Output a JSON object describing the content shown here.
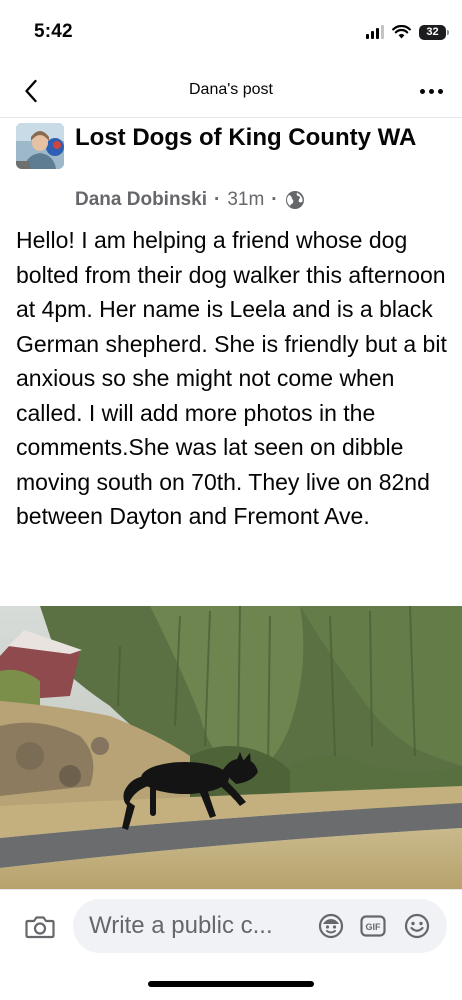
{
  "status_bar": {
    "time": "5:42",
    "battery": "32"
  },
  "nav": {
    "title": "Dana's post"
  },
  "post": {
    "group_name": "Lost Dogs of King County WA",
    "author": "Dana Dobinski",
    "separator": "·",
    "time_ago": "31m",
    "privacy_icon": "globe-icon",
    "body": "Hello! I am helping a friend whose dog bolted from their dog walker this afternoon at 4pm. Her name is Leela and is a black German shepherd. She is friendly but a bit anxious so she might not come when called. I will add more photos in the comments.She was lat seen on dibble moving south on 70th. They live on 82nd between Dayton and Fremont Ave."
  },
  "comment_bar": {
    "placeholder": "Write a public c...",
    "gif_label": "GIF",
    "icons": [
      "camera-icon",
      "avatar-sticker-icon",
      "gif-icon",
      "emoji-icon"
    ]
  },
  "colors": {
    "text_primary": "#050505",
    "text_secondary": "#65676b",
    "input_bg": "#f0f2f5",
    "divider": "#e4e6eb"
  }
}
